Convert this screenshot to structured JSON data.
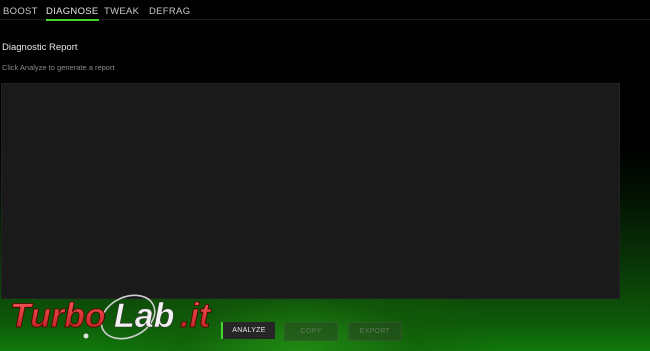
{
  "tabs": {
    "boost": "BOOST",
    "diagnose": "DIAGNOSE",
    "tweak": "TWEAK",
    "defrag": "DEFRAG",
    "active": "DIAGNOSE"
  },
  "main": {
    "title": "Diagnostic Report",
    "hint": "Click Analyze to generate a report"
  },
  "actions": {
    "analyze": "ANALYZE",
    "copy": "COPY",
    "export": "EXPORT"
  },
  "watermark": {
    "text_turbo": "Turbo",
    "text_lab": "Lab",
    "text_it": ".it"
  },
  "colors": {
    "accent": "#44d62c",
    "background": "#000000",
    "panel": "#1a1a1a"
  }
}
